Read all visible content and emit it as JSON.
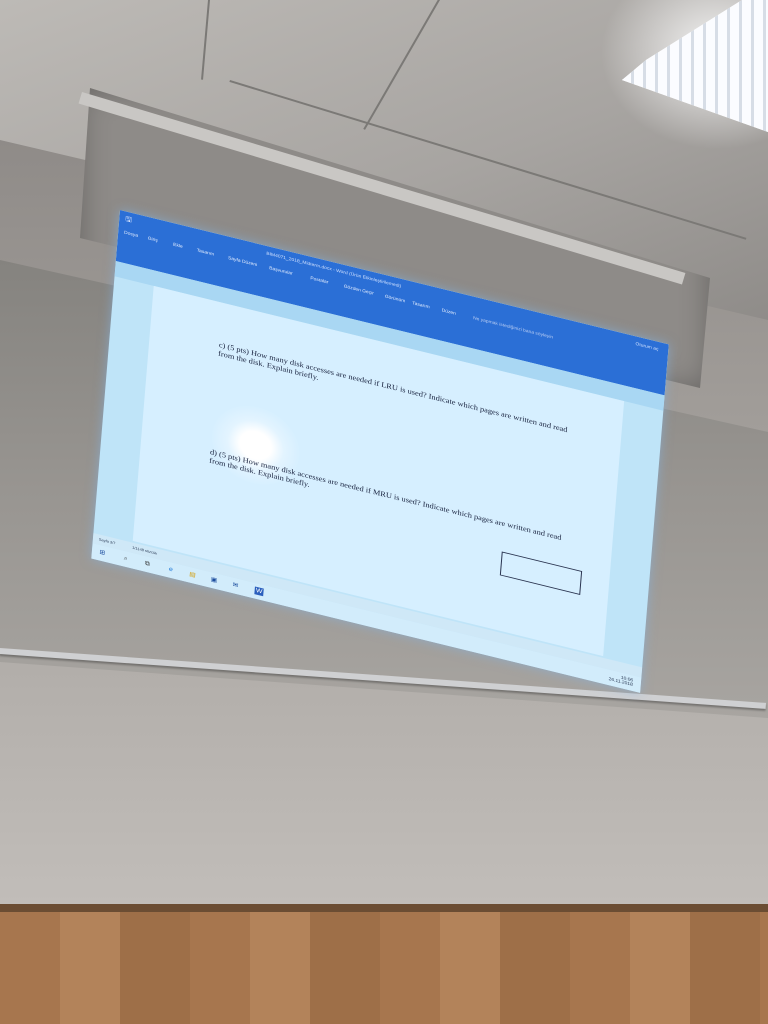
{
  "window": {
    "title": "BIM4071_2018_Midterm.docx - Word (Ürün Etkinleştirilemedi)",
    "quick_access_save": "🖫",
    "login": "Oturum aç",
    "share": "Paylaş"
  },
  "ribbon": {
    "tabs": [
      "Dosya",
      "Giriş",
      "Ekle",
      "Tasarım",
      "Sayfa Düzeni",
      "Başvurular",
      "Postalar",
      "Gözden Geçir",
      "Görünüm",
      "Tasarım",
      "Düzen"
    ],
    "search_placeholder": "Ne yapmak istediğinizi bana söyleyin"
  },
  "document": {
    "questions": [
      {
        "label": "c)",
        "text": "(5 pts) How many disk accesses are needed if LRU is used? Indicate which pages are written and read from the disk. Explain briefly."
      },
      {
        "label": "d)",
        "text": "(5 pts) How many disk accesses are needed if MRU is used? Indicate which pages are written and read from the disk. Explain briefly."
      }
    ]
  },
  "status_bar": {
    "page": "Sayfa 3/7",
    "words": "1/1148 sözcük"
  },
  "taskbar": {
    "icons": [
      "windows-start-icon",
      "search-icon",
      "task-view-icon",
      "edge-browser-icon",
      "file-explorer-icon",
      "store-icon",
      "mail-icon",
      "word-icon"
    ],
    "clock_time": "10:06",
    "clock_date": "26.11.2018"
  },
  "colors": {
    "ribbon": "#2b6fd6",
    "screen_background": "#bfe4f8",
    "text": "#1a2440"
  }
}
